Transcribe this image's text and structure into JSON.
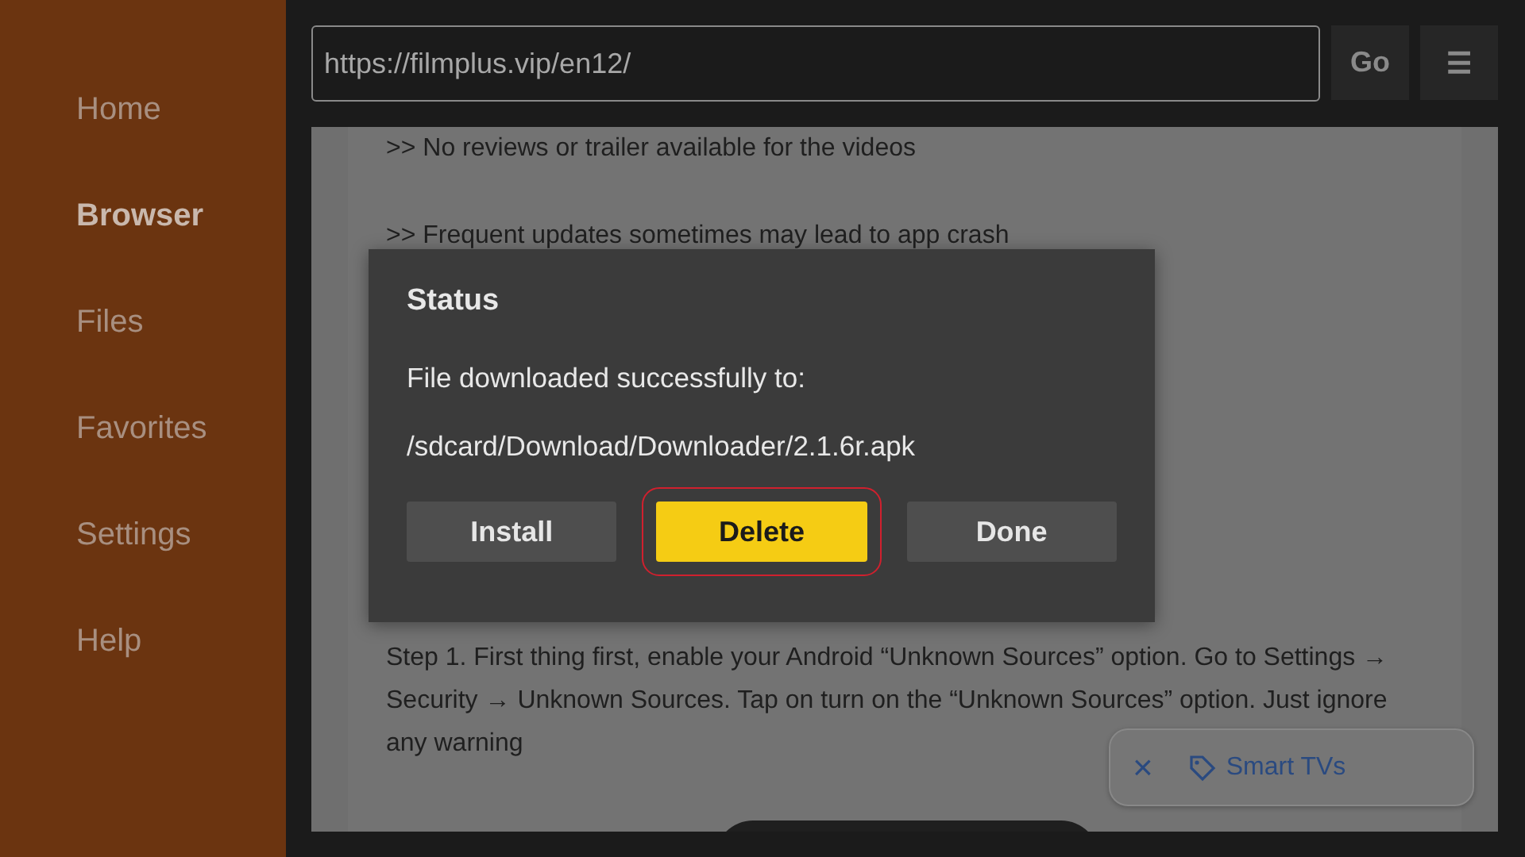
{
  "sidebar": {
    "items": [
      {
        "label": "Home",
        "selected": false
      },
      {
        "label": "Browser",
        "selected": true
      },
      {
        "label": "Files",
        "selected": false
      },
      {
        "label": "Favorites",
        "selected": false
      },
      {
        "label": "Settings",
        "selected": false
      },
      {
        "label": "Help",
        "selected": false
      }
    ]
  },
  "browser": {
    "url": "https://filmplus.vip/en12/",
    "go_button": "Go",
    "menu_button": "☰",
    "page": {
      "paragraphs": [
        ">> No reviews or trailer available for the videos",
        ">> Frequent updates sometimes may lead to app crash",
        "Step 1. First thing first, enable your Android “Unknown Sources” option. Go to Settings → Security → Unknown Sources. Tap on turn on the “Unknown Sources” option. Just ignore any warning"
      ],
      "chip": {
        "close": "×",
        "label": "Smart TVs"
      }
    }
  },
  "dialog": {
    "title": "Status",
    "message": "File downloaded successfully to:",
    "path": "/sdcard/Download/Downloader/2.1.6r.apk",
    "buttons": [
      {
        "label": "Install",
        "selected": false
      },
      {
        "label": "Delete",
        "selected": true
      },
      {
        "label": "Done",
        "selected": false
      }
    ]
  }
}
